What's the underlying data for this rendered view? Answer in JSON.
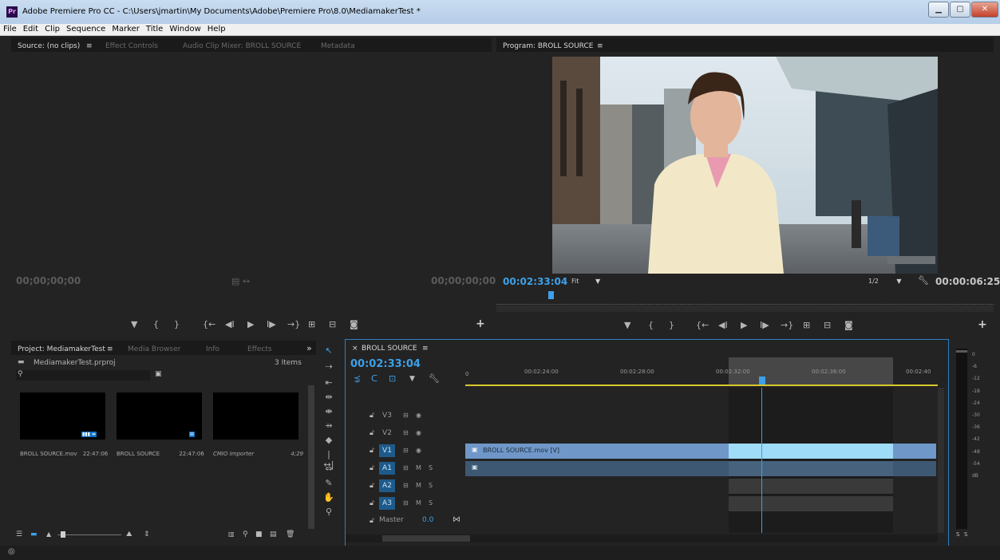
{
  "window": {
    "title": "Adobe Premiere Pro CC - C:\\Users\\jmartin\\My Documents\\Adobe\\Premiere Pro\\8.0\\MediamakerTest *",
    "app_icon": "Pr"
  },
  "menu": [
    "File",
    "Edit",
    "Clip",
    "Sequence",
    "Marker",
    "Title",
    "Window",
    "Help"
  ],
  "source_panel": {
    "tabs": [
      "Source: (no clips)",
      "Effect Controls",
      "Audio Clip Mixer: BROLL SOURCE",
      "Metadata"
    ],
    "tab_menu": "≡",
    "timecode_in": "00;00;00;00",
    "timecode_out": "00;00;00;00"
  },
  "program_panel": {
    "tab": "Program: BROLL SOURCE",
    "tab_menu": "≡",
    "timecode": "00:02:33:04",
    "fit": "Fit",
    "resolution": "1/2",
    "duration": "00:00:06:25"
  },
  "project_panel": {
    "tabs": [
      "Project: MediamakerTest",
      "Media Browser",
      "Info",
      "Effects"
    ],
    "tab_menu": "≡",
    "overflow": "»",
    "project_file": "MediamakerTest.prproj",
    "items_count": "3 Items",
    "search_placeholder": "",
    "items": [
      {
        "name": "BROLL SOURCE.mov",
        "duration": "22:47:06"
      },
      {
        "name": "BROLL SOURCE",
        "duration": "22:47:06"
      },
      {
        "name": "CMIO Importer",
        "duration": "4;29"
      }
    ]
  },
  "timeline": {
    "tab": "BROLL SOURCE",
    "close": "×",
    "tab_menu": "≡",
    "timecode": "00:02:33:04",
    "ruler": [
      "0",
      "00:02:24:00",
      "00:02:28:00",
      "00:02:32:00",
      "00:02:36:00",
      "00:02:40"
    ],
    "video_tracks": [
      "V3",
      "V2",
      "V1"
    ],
    "audio_tracks": [
      "A1",
      "A2",
      "A3"
    ],
    "master_label": "Master",
    "master_value": "0.0",
    "clip_video": "BROLL SOURCE.mov [V]",
    "track_m": "M",
    "track_s": "S"
  },
  "meter": {
    "scale": [
      "0",
      "-6",
      "-12",
      "-18",
      "-24",
      "-30",
      "-36",
      "-42",
      "-48",
      "-54",
      "dB"
    ],
    "solo": [
      "S",
      "S"
    ]
  },
  "colors": {
    "accent": "#3da0e8",
    "clip_video": "#6f97c8",
    "clip_audio": "#3d5873",
    "workarea": "#7a7a7a",
    "playhead": "#3da0e8"
  }
}
